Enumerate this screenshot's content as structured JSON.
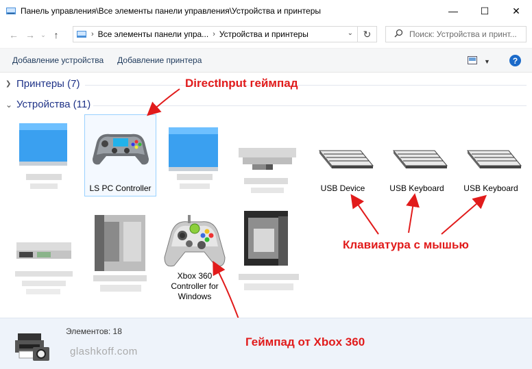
{
  "window": {
    "title": "Панель управления\\Все элементы панели управления\\Устройства и принтеры",
    "minimize": "—",
    "maximize": "☐",
    "close": "✕"
  },
  "address": {
    "crumb1": "Все элементы панели упра...",
    "crumb2": "Устройства и принтеры",
    "search_placeholder": "Поиск: Устройства и принт..."
  },
  "commands": {
    "add_device": "Добавление устройства",
    "add_printer": "Добавление принтера",
    "help": "?"
  },
  "groups": {
    "printers": "Принтеры (7)",
    "devices": "Устройства (11)"
  },
  "devices": [
    {
      "label": "LS PC Controller"
    },
    {
      "label": "USB Device"
    },
    {
      "label": "USB Keyboard"
    },
    {
      "label": "USB Keyboard"
    },
    {
      "label_lines": [
        "Xbox 360",
        "Controller for",
        "Windows"
      ]
    }
  ],
  "annotations": {
    "directinput": "DirectInput геймпад",
    "keyboard_mouse": "Клавиатура с мышью",
    "xbox": "Геймпад от Xbox 360"
  },
  "status": {
    "count": "Элементов: 18",
    "watermark": "glashkoff.com"
  },
  "colors": {
    "annotation": "#e11b1b",
    "group_header": "#1e3287",
    "command_text": "#1e395b"
  }
}
